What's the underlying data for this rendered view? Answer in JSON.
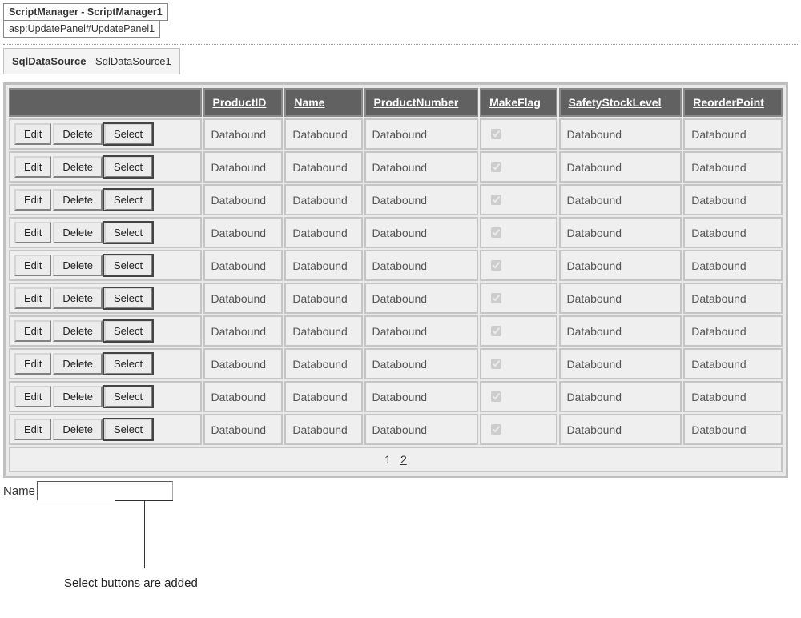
{
  "scriptManagerTag": "ScriptManager - ScriptManager1",
  "updatePanelTag": "asp:UpdatePanel#UpdatePanel1",
  "dataSourceLabelBold": "SqlDataSource",
  "dataSourceLabelRest": " - SqlDataSource1",
  "columns": [
    "ProductID",
    "Name",
    "ProductNumber",
    "MakeFlag",
    "SafetyStockLevel",
    "ReorderPoint"
  ],
  "buttons": {
    "edit": "Edit",
    "delete": "Delete",
    "select": "Select"
  },
  "cellText": "Databound",
  "rowCount": 10,
  "makeFlagChecked": true,
  "pager": {
    "current": "1",
    "other": "2"
  },
  "nameFieldLabel": "Name",
  "nameFieldValue": "",
  "calloutText": "Select buttons are added"
}
